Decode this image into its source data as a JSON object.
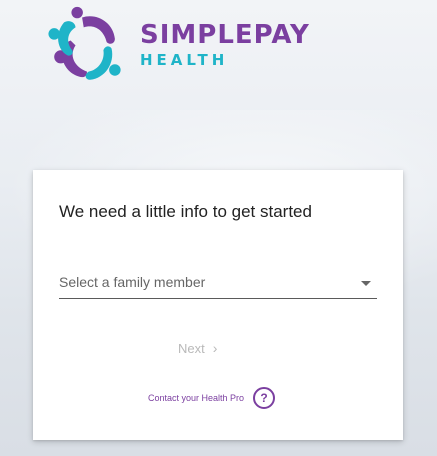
{
  "brand": {
    "name": "SIMPLEPAY",
    "sub": "HEALTH",
    "primary_color": "#7b3fa0",
    "accent_color": "#1fb4c8"
  },
  "card": {
    "title": "We need a little info to get started",
    "family_select": {
      "placeholder": "Select a family member",
      "icon": "caret-down-icon"
    },
    "next_label": "Next",
    "next_icon": "chevron-right-icon",
    "next_enabled": false,
    "contact_label": "Contact your Health Pro",
    "help_icon": "question-circle-icon",
    "help_symbol": "?"
  }
}
